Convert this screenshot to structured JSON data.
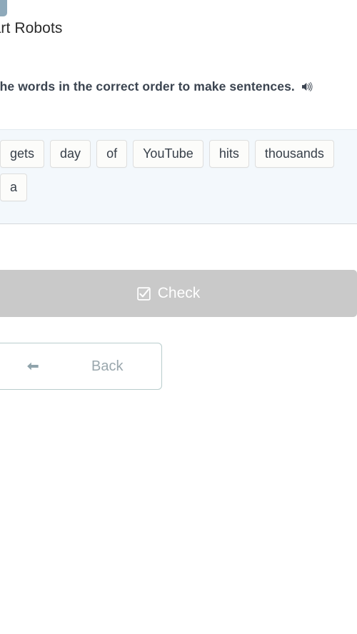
{
  "header": {
    "icon": "task-document-icon",
    "lesson_title": "mart Robots",
    "lesson_title_full": "Smart Robots"
  },
  "instruction": {
    "text": "ut the words in the correct order to make sentences.",
    "text_full": "Put the words in the correct order to make sentences.",
    "audio_icon": "speaker-icon"
  },
  "word_bank": {
    "tiles": [
      {
        "label": "gets"
      },
      {
        "label": "day"
      },
      {
        "label": "of"
      },
      {
        "label": "YouTube"
      },
      {
        "label": "hits"
      },
      {
        "label": "thousands"
      },
      {
        "label": "a"
      }
    ]
  },
  "actions": {
    "check_label": "Check",
    "check_icon": "checkbox-checked-icon",
    "check_disabled": true,
    "back_label": "Back",
    "back_icon": "arrow-left-icon"
  },
  "colors": {
    "panel_background": "#f3f8fc",
    "tile_background": "#fcfcfa",
    "tile_border": "#dedede",
    "check_disabled_background": "#c9c9c9",
    "check_label_color": "#ffffff",
    "back_border": "#b9cdcd",
    "back_label_color": "#9aa7ad",
    "title_color": "#2b2b2b",
    "instruction_color": "#3b4450",
    "task_icon_color": "#8ea9ba"
  }
}
